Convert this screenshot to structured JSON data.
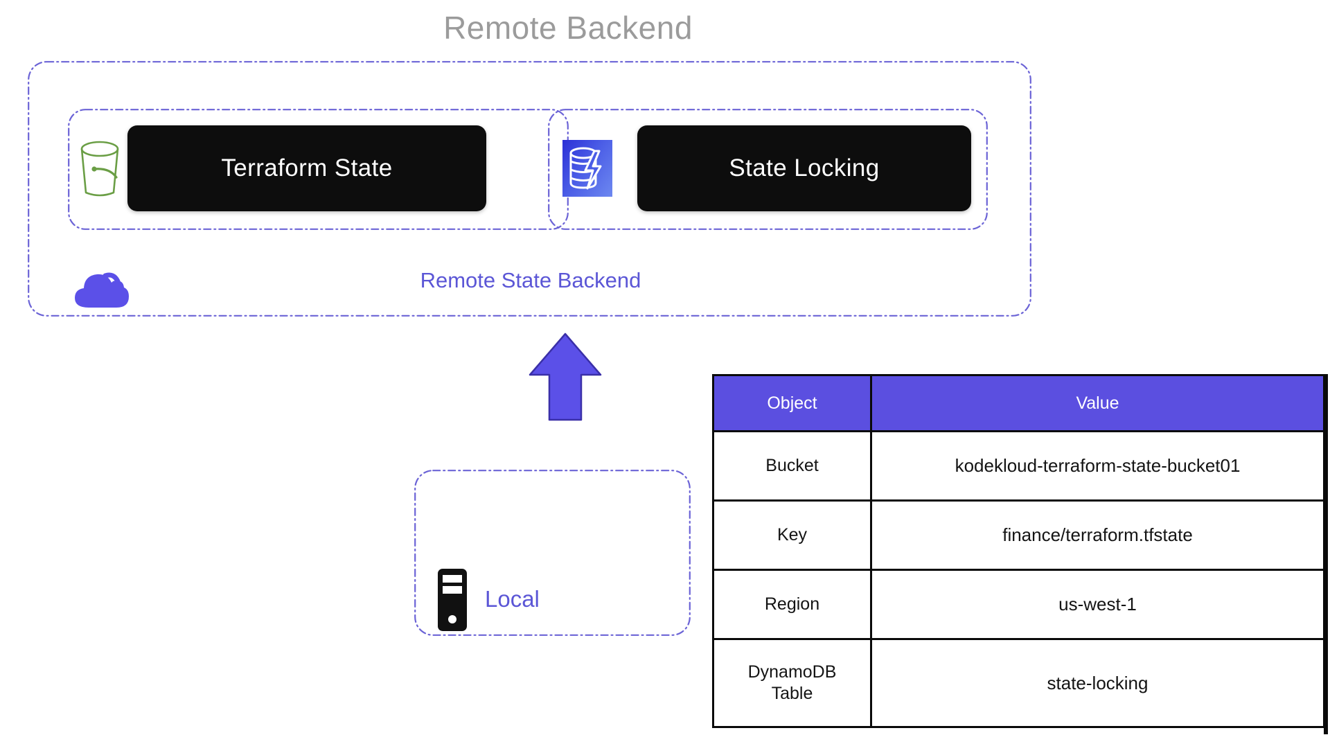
{
  "title": "Remote Backend",
  "backend": {
    "container_label": "Remote State Backend",
    "cloud_icon": "cloud-icon",
    "groups": [
      {
        "icon": "s3-bucket-icon",
        "label": "Terraform State"
      },
      {
        "icon": "dynamodb-icon",
        "label": "State Locking"
      }
    ]
  },
  "local": {
    "label": "Local",
    "icon": "server-tower-icon"
  },
  "flow": {
    "arrow": "arrow-up-icon",
    "direction": "local-to-remote"
  },
  "table": {
    "headers": [
      "Object",
      "Value"
    ],
    "rows": [
      {
        "object": "Bucket",
        "value": "kodekloud-terraform-state-bucket01"
      },
      {
        "object": "Key",
        "value": "finance/terraform.tfstate"
      },
      {
        "object": "Region",
        "value": "us-west-1"
      },
      {
        "object": "DynamoDB Table",
        "value": "state-locking"
      }
    ]
  },
  "colors": {
    "accent_purple": "#5b4fe0",
    "label_purple": "#5b56d6",
    "dashed_border": "#6b63d6",
    "box_black": "#0d0d0d",
    "title_gray": "#9b9b9b",
    "bucket_green": "#6a9e45",
    "dynamodb_blue": "#3a46dd"
  }
}
